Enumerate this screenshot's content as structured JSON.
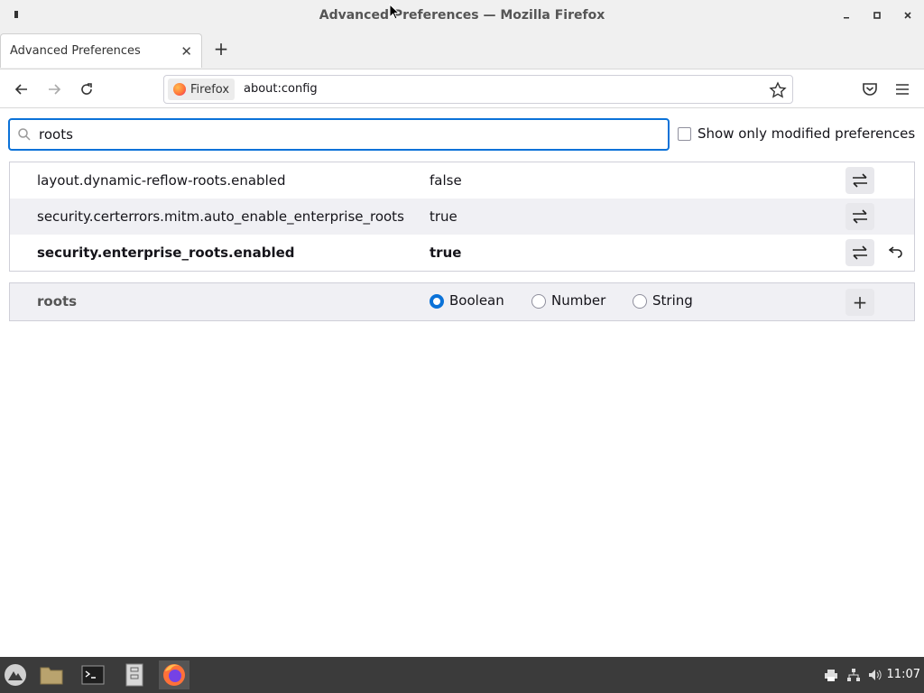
{
  "window": {
    "title": "Advanced Preferences — Mozilla Firefox"
  },
  "tabs": [
    {
      "title": "Advanced Preferences"
    }
  ],
  "navbar": {
    "identity_label": "Firefox",
    "url": "about:config"
  },
  "config": {
    "search_value": "roots",
    "show_modified_label": "Show only modified preferences",
    "show_modified_checked": false,
    "prefs": [
      {
        "name": "layout.dynamic-reflow-roots.enabled",
        "value": "false",
        "modified": false
      },
      {
        "name": "security.certerrors.mitm.auto_enable_enterprise_roots",
        "value": "true",
        "modified": false
      },
      {
        "name": "security.enterprise_roots.enabled",
        "value": "true",
        "modified": true
      }
    ],
    "new_pref": {
      "name": "roots",
      "types": [
        "Boolean",
        "Number",
        "String"
      ],
      "selected_type": "Boolean"
    }
  },
  "taskbar": {
    "clock": "11:07"
  },
  "colors": {
    "accent": "#0b72d8",
    "taskbar": "#3b3b3b"
  }
}
